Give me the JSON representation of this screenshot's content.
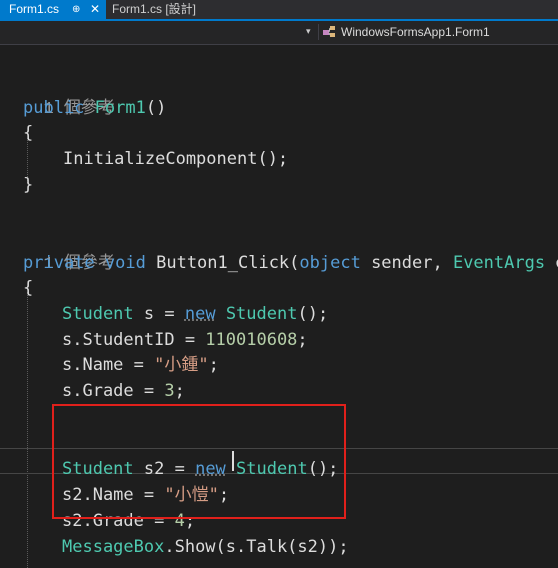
{
  "tabs": [
    {
      "label": "Form1.cs",
      "pin": "⊕",
      "close": "✕"
    },
    {
      "label": "Form1.cs [設計]"
    }
  ],
  "nav": {
    "left_dropdown": "▾",
    "class_selector": "WindowsFormsApp1.Form1"
  },
  "code": {
    "ref1": "1 個參考",
    "ctor_mod": "public",
    "ctor_name": "Form1",
    "ctor_parens": "()",
    "brace_open": "{",
    "brace_close": "}",
    "init_call": "InitializeComponent();",
    "ref2": "1 個參考",
    "m_private": "private",
    "m_void": "void",
    "m_name": "Button1_Click(",
    "m_object": "object",
    "m_sender": " sender, ",
    "m_eventargs": "EventArgs",
    "m_e": " e)",
    "s_type": "Student",
    "s_decl": " s = ",
    "kw_new": "new",
    "s_ctor": "Student",
    "call_end": "();",
    "sid_prefix": "s.StudentID = ",
    "sid_value": "110010608",
    "semicolon": ";",
    "sname_prefix": "s.Name = ",
    "sname_value": "\"小鍾\"",
    "sgrade_prefix": "s.Grade = ",
    "sgrade_value": "3",
    "s2_type": "Student",
    "s2_decl": " s2 = ",
    "s2_ctor": "Student",
    "s2name_prefix": "s2.Name = ",
    "s2name_value": "\"小愷\"",
    "s2grade_prefix": "s2.Grade = ",
    "s2grade_value": "4",
    "msgbox_type": "MessageBox",
    "msgbox_call": ".Show(s.Talk(s2));"
  }
}
